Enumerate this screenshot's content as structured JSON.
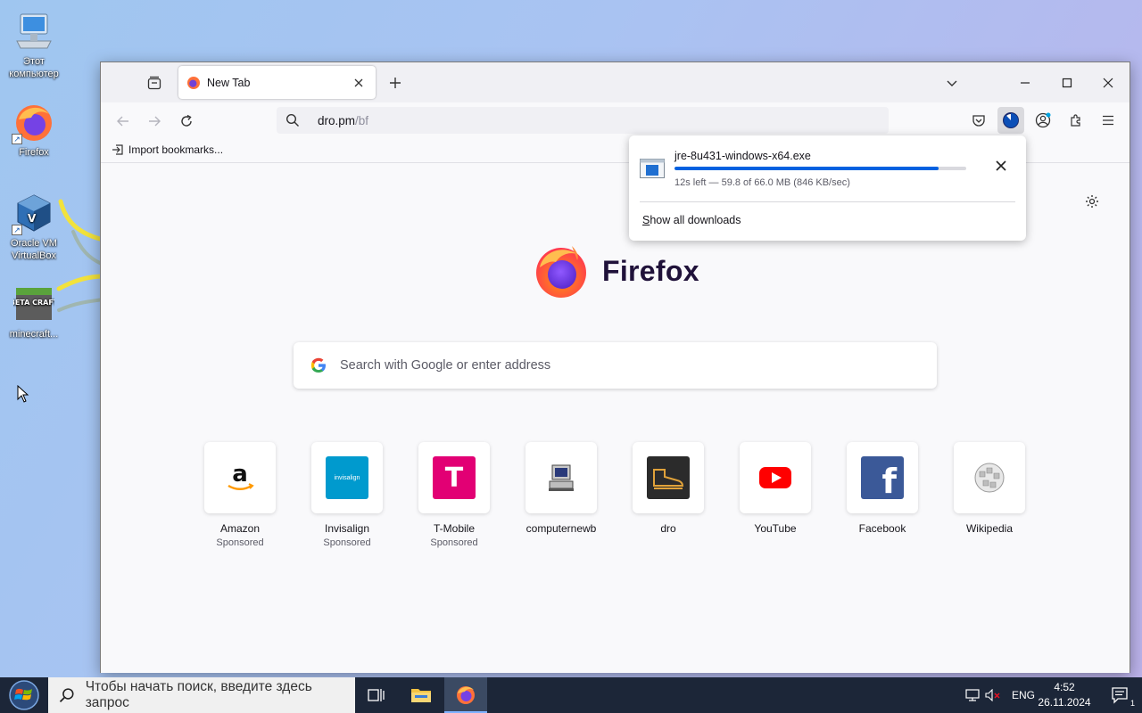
{
  "desktop": {
    "icons": [
      {
        "label": "Этот компьютер",
        "icon": "computer-icon"
      },
      {
        "label": "Firefox",
        "icon": "firefox-icon"
      },
      {
        "label": "Oracle VM VirtualBox",
        "icon": "virtualbox-icon"
      },
      {
        "label": "minecraft...",
        "icon": "beta-craft-icon"
      }
    ],
    "beta_craft_logo_text": "BETA CRAFT"
  },
  "browser": {
    "tab": {
      "title": "New Tab",
      "icon": "firefox-favicon"
    },
    "url": {
      "host": "dro.pm",
      "path": "/bf"
    },
    "bookmarks_bar": {
      "import_label": "Import bookmarks..."
    },
    "brand": {
      "wordmark": "Firefox"
    },
    "search": {
      "placeholder": "Search with Google or enter address",
      "engine_icon": "google-icon"
    },
    "top_sites": [
      {
        "name": "Amazon",
        "sponsored": "Sponsored",
        "icon": "amazon-logo",
        "bg": "#ffffff"
      },
      {
        "name": "Invisalign",
        "sponsored": "Sponsored",
        "icon": "invisalign-logo",
        "bg": "#009ace",
        "logo_text": "invisalign"
      },
      {
        "name": "T-Mobile",
        "sponsored": "Sponsored",
        "icon": "t-mobile-logo",
        "bg": "#e20074",
        "logo_text": "T"
      },
      {
        "name": "computernewb",
        "sponsored": "",
        "icon": "computernewb-logo",
        "bg": "#ffffff"
      },
      {
        "name": "dro",
        "sponsored": "",
        "icon": "dro-logo",
        "bg": "#2b2b2b"
      },
      {
        "name": "YouTube",
        "sponsored": "",
        "icon": "youtube-logo",
        "bg": "#ffffff"
      },
      {
        "name": "Facebook",
        "sponsored": "",
        "icon": "facebook-logo",
        "bg": "#3b5998",
        "logo_text": "f"
      },
      {
        "name": "Wikipedia",
        "sponsored": "",
        "icon": "wikipedia-logo",
        "bg": "#ffffff"
      }
    ],
    "downloads": {
      "file_name": "jre-8u431-windows-x64.exe",
      "status": "12s left — 59.8 of 66.0 MB (846 KB/sec)",
      "progress_fraction": 0.906,
      "show_all_label": "Show all downloads",
      "show_all_accesskey": "S",
      "show_all_rest": "how all downloads"
    },
    "colors": {
      "accent": "#0061e0",
      "chrome_bg": "#f0f0f4",
      "content_bg": "#f9f9fb"
    }
  },
  "taskbar": {
    "search_placeholder": "Чтобы начать поиск, введите здесь запрос",
    "language": "ENG",
    "time": "4:52",
    "date": "26.11.2024",
    "notification_count": "1"
  }
}
